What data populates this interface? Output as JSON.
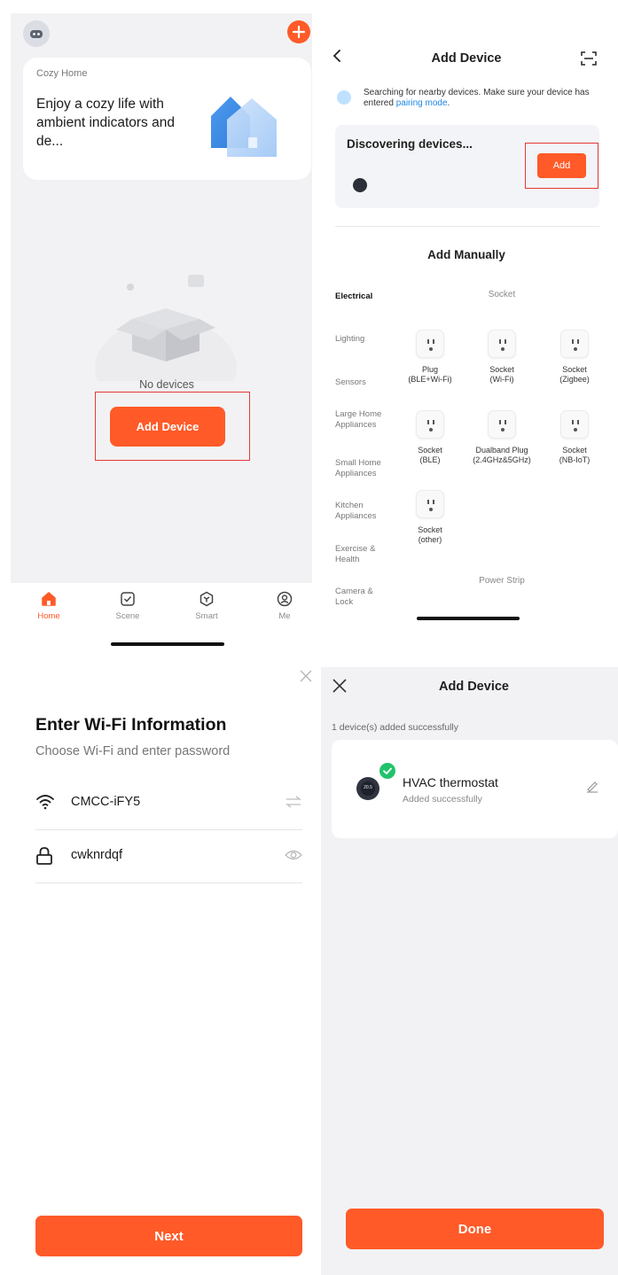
{
  "home": {
    "home_name": "Cozy Home",
    "message": "Enjoy a cozy life with ambient indicators and de...",
    "empty_text": "No devices",
    "add_device_label": "Add Device",
    "tabs": [
      {
        "label": "Home",
        "icon": "home-icon",
        "active": true
      },
      {
        "label": "Scene",
        "icon": "scene-icon",
        "active": false
      },
      {
        "label": "Smart",
        "icon": "smart-icon",
        "active": false
      },
      {
        "label": "Me",
        "icon": "profile-icon",
        "active": false
      }
    ]
  },
  "add_device": {
    "title": "Add Device",
    "search_text": "Searching for nearby devices. Make sure your device has entered ",
    "pairing_link": "pairing mode",
    "search_end": ".",
    "discovering": "Discovering devices...",
    "add_label": "Add",
    "manual_title": "Add Manually",
    "categories": [
      {
        "label": "Electrical",
        "active": true
      },
      {
        "label": "Lighting",
        "active": false
      },
      {
        "label": "Sensors",
        "active": false
      },
      {
        "label": "Large Home Appliances",
        "active": false
      },
      {
        "label": "Small Home Appliances",
        "active": false
      },
      {
        "label": "Kitchen Appliances",
        "active": false
      },
      {
        "label": "Exercise & Health",
        "active": false
      },
      {
        "label": "Camera & Lock",
        "active": false
      }
    ],
    "section_socket": "Socket",
    "section_power_strip": "Power Strip",
    "items": [
      {
        "name": "Plug",
        "sub": "(BLE+Wi-Fi)",
        "icon": "socket-icon"
      },
      {
        "name": "Socket",
        "sub": "(Wi-Fi)",
        "icon": "socket-icon"
      },
      {
        "name": "Socket",
        "sub": "(Zigbee)",
        "icon": "socket-icon"
      },
      {
        "name": "Socket",
        "sub": "(BLE)",
        "icon": "socket-icon"
      },
      {
        "name": "Dualband Plug",
        "sub": "(2.4GHz&5GHz)",
        "icon": "socket-icon"
      },
      {
        "name": "Socket",
        "sub": "(NB-IoT)",
        "icon": "socket-icon"
      },
      {
        "name": "Socket",
        "sub": "(other)",
        "icon": "socket-icon"
      }
    ]
  },
  "wifi": {
    "heading": "Enter Wi-Fi Information",
    "subheading": "Choose Wi-Fi and enter password",
    "ssid": "CMCC-iFY5",
    "password": "cwknrdqf",
    "next_label": "Next"
  },
  "added": {
    "title": "Add Device",
    "success_count": "1 device(s) added successfully",
    "device_name": "HVAC thermostat",
    "device_status": "Added successfully",
    "thermostat_reading": "20.5",
    "done_label": "Done"
  },
  "colors": {
    "accent": "#ff5a28",
    "highlight": "#e53935",
    "success": "#22c26a",
    "link": "#1e88e5"
  }
}
